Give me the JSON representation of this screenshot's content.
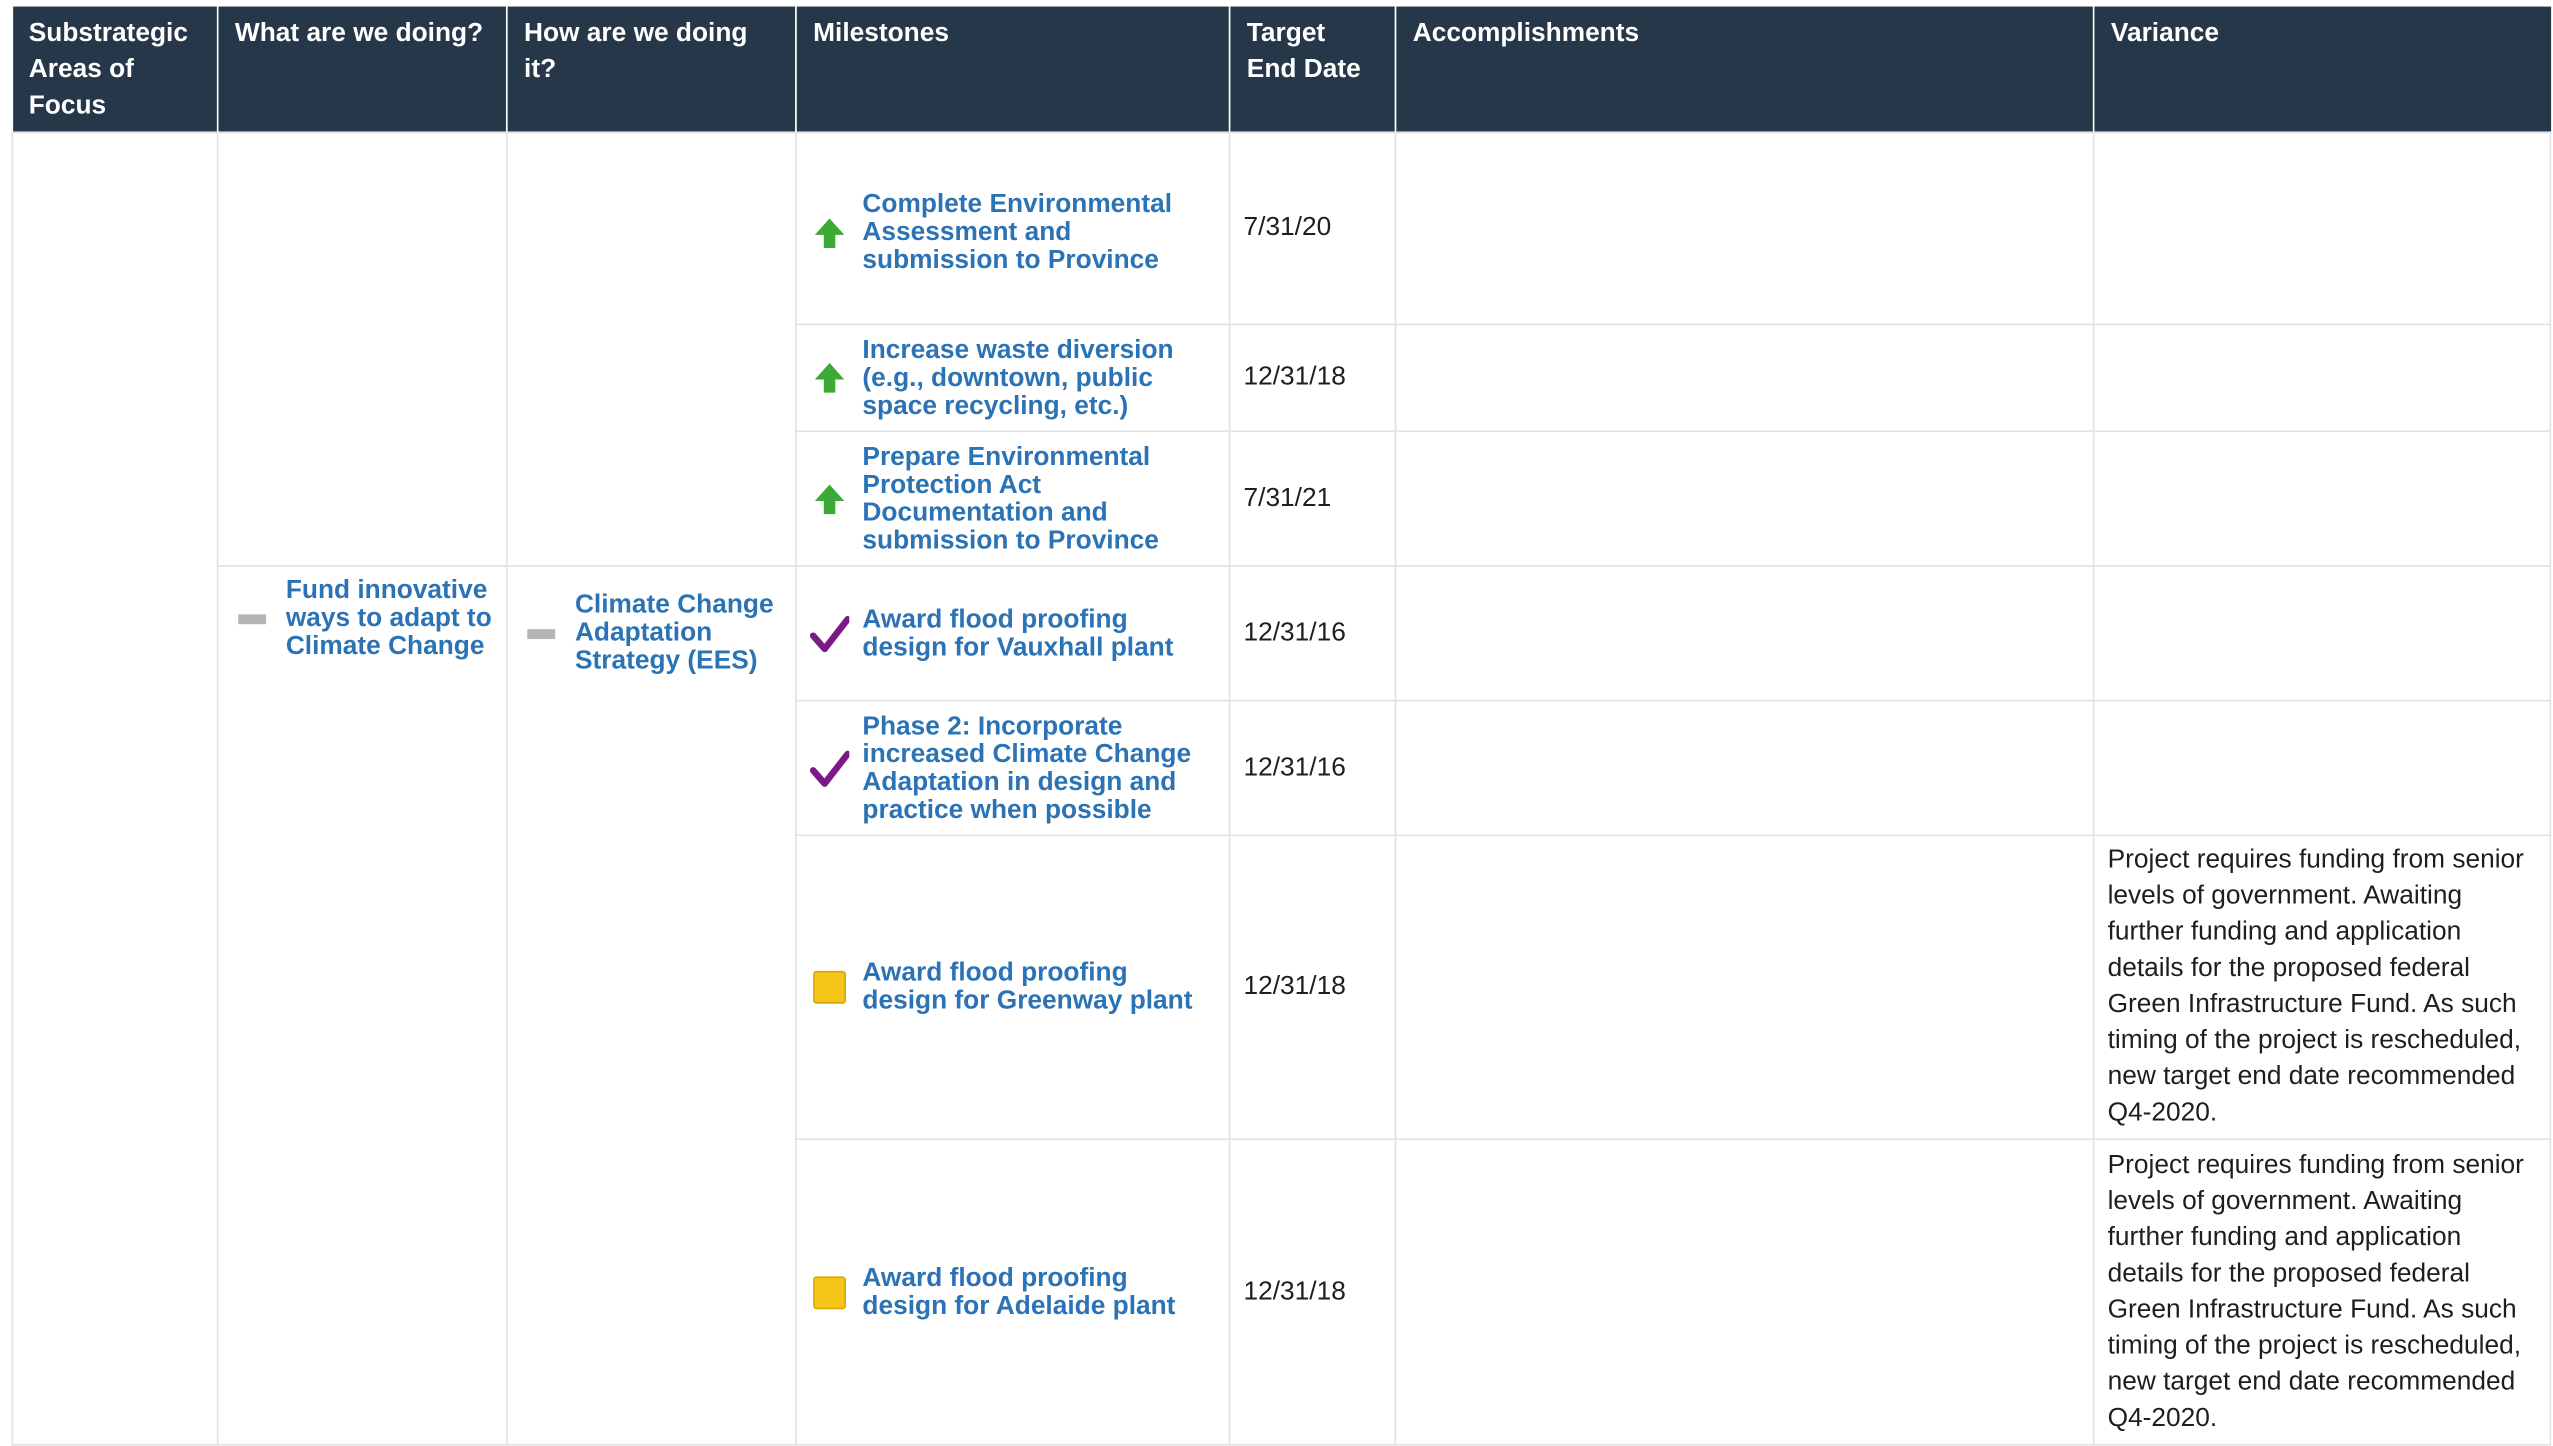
{
  "headers": {
    "col1": "Substrategic Areas of Focus",
    "col2": "What are we doing?",
    "col3": "How are we doing it?",
    "col4": "Milestones",
    "col5": "Target End Date",
    "col6": "Accomplishments",
    "col7": "Variance"
  },
  "group": {
    "what": "Fund innovative ways to adapt to Climate Change",
    "how": "Climate Change Adaptation Strategy (EES)"
  },
  "milestones": [
    {
      "label": "Complete Environmental Assessment and submission to Province",
      "date": "7/31/20",
      "status_icon": "green-up-arrow-icon",
      "variance": ""
    },
    {
      "label": "Increase waste diversion (e.g., downtown, public space recycling, etc.)",
      "date": "12/31/18",
      "status_icon": "green-up-arrow-icon",
      "variance": ""
    },
    {
      "label": "Prepare Environmental Protection Act Documentation and submission to Province",
      "date": "7/31/21",
      "status_icon": "green-up-arrow-icon",
      "variance": ""
    },
    {
      "label": "Award flood proofing design for Vauxhall plant",
      "date": "12/31/16",
      "status_icon": "purple-checkmark-icon",
      "variance": ""
    },
    {
      "label": "Phase 2: Incorporate increased Climate Change Adaptation in design and practice when possible",
      "date": "12/31/16",
      "status_icon": "purple-checkmark-icon",
      "variance": ""
    },
    {
      "label": "Award flood proofing design for Greenway plant",
      "date": "12/31/18",
      "status_icon": "yellow-square-icon",
      "variance": "Project requires funding from senior levels of government. Awaiting further funding and application details for the proposed federal Green Infrastructure Fund. As such timing of the project is rescheduled, new target end date recommended Q4-2020."
    },
    {
      "label": "Award flood proofing design for Adelaide plant",
      "date": "12/31/18",
      "status_icon": "yellow-square-icon",
      "variance": "Project requires funding from senior levels of government. Awaiting further funding and application details for the proposed federal Green Infrastructure Fund. As such timing of the project is rescheduled, new target end date recommended Q4-2020."
    }
  ],
  "colors": {
    "header_bg": "#253748",
    "link": "#2b73b5",
    "status_green": "#3daa35",
    "status_purple": "#7b1a86",
    "status_yellow": "#f5c518",
    "dash_gray": "#b5b5b5"
  }
}
